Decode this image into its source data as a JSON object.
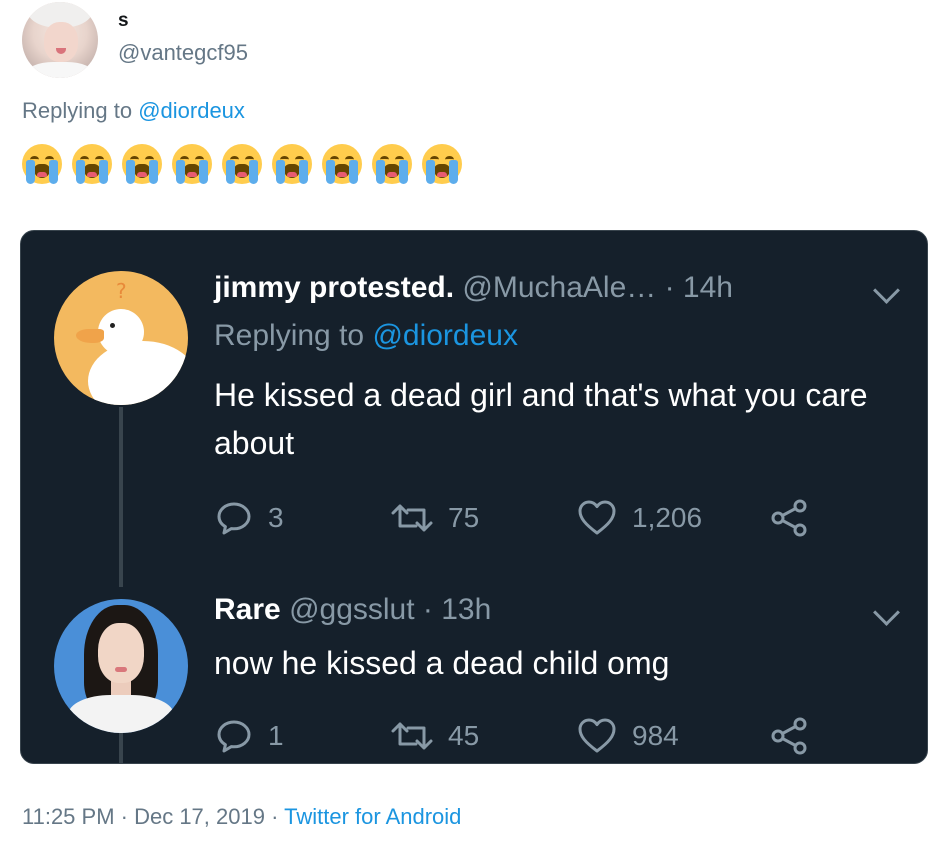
{
  "author": {
    "name": "s",
    "handle": "@vantegcf95"
  },
  "reply_context": {
    "prefix": "Replying to ",
    "mention": "@diordeux"
  },
  "emoji_row": {
    "emoji": "loudly-crying-face",
    "count": 9
  },
  "quoted_thread": [
    {
      "name": "jimmy protested.",
      "handle": "@MuchaAle…",
      "time": " · 14h",
      "reply_prefix": "Replying to ",
      "reply_mention": "@diordeux",
      "text": "He kissed a dead girl and that's what you care  about",
      "replies": "3",
      "retweets": "75",
      "likes": "1,206"
    },
    {
      "name": "Rare",
      "handle": "@ggsslut",
      "time": " · 13h",
      "text": "now he kissed a dead child omg",
      "replies": "1",
      "retweets": "45",
      "likes": "984"
    }
  ],
  "footer": {
    "timestamp": "11:25 PM · Dec 17, 2019 · ",
    "client": "Twitter for Android"
  },
  "colors": {
    "card_bg": "#15202b",
    "link": "#1b95e0",
    "muted": "#8899a6"
  }
}
